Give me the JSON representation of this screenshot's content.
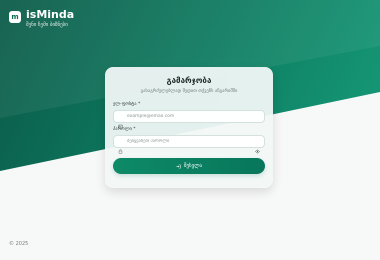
{
  "brand": {
    "logo_text": "m",
    "name": "isMinda",
    "tagline": "შენი ჩემი ბიზნესი"
  },
  "auth": {
    "title": "გამარჯობა",
    "subtitle": "გასაგრძელებლად შედით თქვენს ანგარიშში",
    "email_label": "ელ-ფოსტა *",
    "email_placeholder": "example@email.com",
    "password_label": "პაროლი *",
    "password_placeholder": "შეიყვანეთ პაროლი",
    "submit_label": "შესვლა"
  },
  "footer": {
    "copyright": "© 2025"
  },
  "icons": {
    "brand": "logo-icon",
    "email": "mail-icon",
    "password": "lock-icon",
    "visibility": "eye-icon",
    "submit": "sign-in-icon"
  },
  "colors": {
    "primary_dark": "#0b5a48",
    "primary": "#0e7a60",
    "primary_light": "#17a17c",
    "background": "#f7f8f8",
    "card": "#f2f8f6"
  }
}
